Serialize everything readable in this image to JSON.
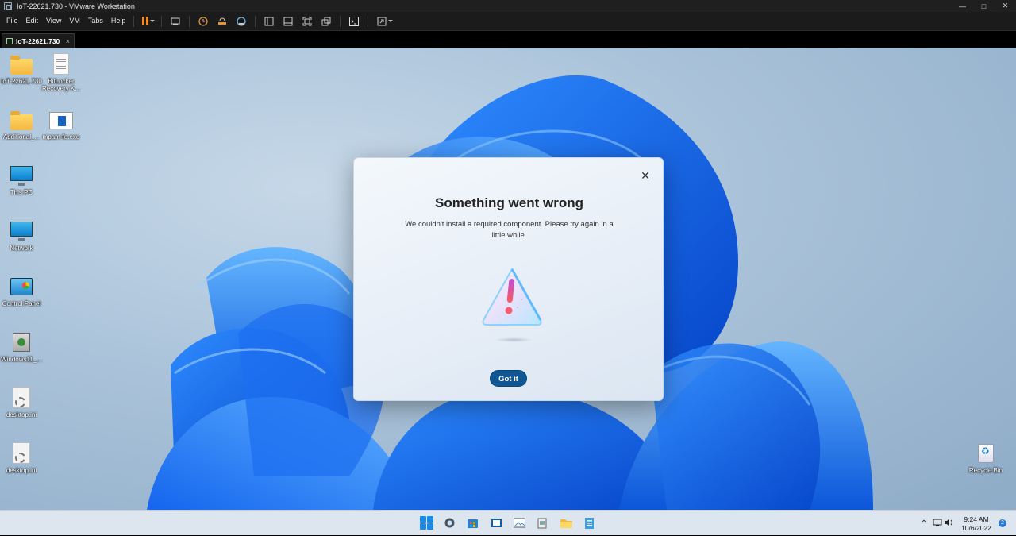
{
  "window": {
    "title": "IoT-22621.730 - VMware Workstation"
  },
  "menu": [
    "File",
    "Edit",
    "View",
    "VM",
    "Tabs",
    "Help"
  ],
  "tab": {
    "label": "IoT-22621.730",
    "close": "×"
  },
  "desktop_icons": [
    {
      "label": "IoT-22621.730",
      "icon": "folder-icon"
    },
    {
      "label": "BitLocker Recovery K...",
      "icon": "document-icon"
    },
    {
      "label": "Additional_...",
      "icon": "folder-icon"
    },
    {
      "label": "mpam-fe.exe",
      "icon": "installer-icon"
    },
    {
      "label": "This PC",
      "icon": "monitor-icon"
    },
    {
      "label": "Network",
      "icon": "network-icon"
    },
    {
      "label": "Control Panel",
      "icon": "control-panel-icon"
    },
    {
      "label": "Windows11_...",
      "icon": "setup-icon"
    },
    {
      "label": "desktop.ini",
      "icon": "ini-file-icon"
    },
    {
      "label": "desktop.ini",
      "icon": "ini-file-icon"
    },
    {
      "label": "Recycle Bin",
      "icon": "recycle-bin-icon"
    }
  ],
  "dialog": {
    "title": "Something went wrong",
    "message": "We couldn't install a required component. Please try again in a little while.",
    "button": "Got it",
    "close": "✕"
  },
  "taskbar": {
    "time": "9:24 AM",
    "date": "10/6/2022",
    "notification_count": "2"
  },
  "colors": {
    "accent": "#0f5794",
    "vmware_pause": "#f08a1e",
    "taskbar": "#dde5ee"
  }
}
